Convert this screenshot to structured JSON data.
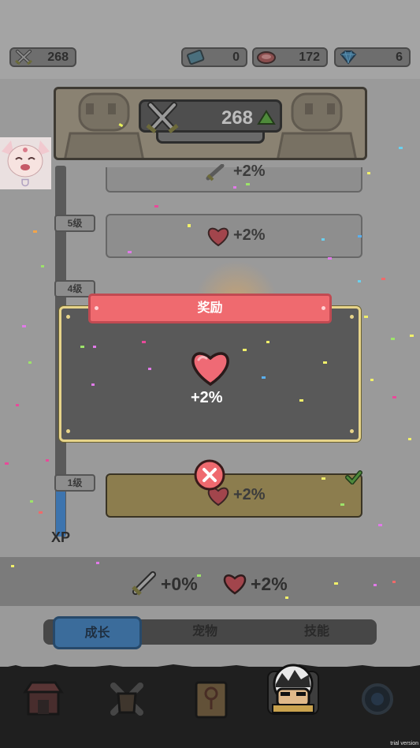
{
  "resources": {
    "power": "268",
    "tickets": "0",
    "meat": "172",
    "gems": "6"
  },
  "header": {
    "combat_power": "268"
  },
  "progression": {
    "levels": [
      {
        "label": "5级"
      },
      {
        "label": "4级"
      },
      {
        "label": "1级"
      }
    ],
    "rows": {
      "cut_label": "+2%",
      "level5_reward": "+2%",
      "level1_reward": "+2%"
    },
    "xp_label": "XP",
    "xp_fill_fraction": 0.13
  },
  "popup": {
    "title": "奖励",
    "reward_value": "+2%"
  },
  "totals": {
    "attack_bonus": "+0%",
    "health_bonus": "+2%"
  },
  "subtabs": {
    "growth": "成长",
    "pets": "宠物",
    "skills": "技能",
    "active": "成长"
  },
  "nav": {
    "items": [
      "shop-icon",
      "equipment-icon",
      "map-icon",
      "hero-icon",
      "portal-icon"
    ],
    "active": "hero-icon"
  },
  "watermark": "trial version",
  "colors": {
    "accent_blue": "#3b6c9b",
    "reward_red": "#ef6a6f",
    "popup_border": "#e7d48a",
    "heart": "#e85560",
    "claimed_row": "#8c7d4e"
  }
}
